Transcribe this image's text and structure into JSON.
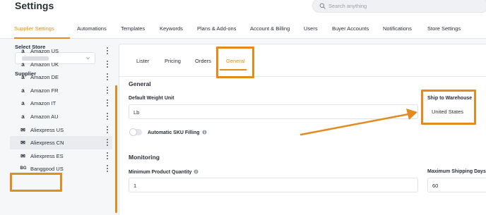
{
  "header": {
    "title": "Settings",
    "search_placeholder": "Search anything",
    "search_icon": "search-icon"
  },
  "nav": {
    "tabs": [
      {
        "label": "Supplier Settings",
        "active": true
      },
      {
        "label": "Automations"
      },
      {
        "label": "Templates"
      },
      {
        "label": "Keywords"
      },
      {
        "label": "Plans & Add-ons"
      },
      {
        "label": "Account & Billing"
      },
      {
        "label": "Users"
      },
      {
        "label": "Buyer Accounts"
      },
      {
        "label": "Notifications"
      },
      {
        "label": "Store Settings"
      }
    ]
  },
  "sidebar": {
    "select_store_label": "Select Store",
    "supplier_label": "Supplier",
    "suppliers": [
      {
        "name": "Amazon US",
        "icon": "amazon-icon",
        "logo": "a"
      },
      {
        "name": "Amazon UK",
        "icon": "amazon-icon",
        "logo": "a"
      },
      {
        "name": "Amazon DE",
        "icon": "amazon-icon",
        "logo": "a"
      },
      {
        "name": "Amazon FR",
        "icon": "amazon-icon",
        "logo": "a"
      },
      {
        "name": "Amazon IT",
        "icon": "amazon-icon",
        "logo": "a"
      },
      {
        "name": "Amazon AU",
        "icon": "amazon-icon",
        "logo": "a"
      },
      {
        "name": "Aliexpress US",
        "icon": "aliexpress-icon",
        "logo": "✉"
      },
      {
        "name": "Aliexpress CN",
        "icon": "aliexpress-icon",
        "logo": "✉",
        "selected": true
      },
      {
        "name": "Aliexpress ES",
        "icon": "aliexpress-icon",
        "logo": "✉"
      },
      {
        "name": "Banggood US",
        "icon": "banggood-icon",
        "logo": "BG"
      }
    ]
  },
  "panel": {
    "subtabs": [
      {
        "label": "Lister"
      },
      {
        "label": "Pricing"
      },
      {
        "label": "Orders"
      },
      {
        "label": "General",
        "active": true
      }
    ],
    "general_title": "General",
    "default_weight_unit_label": "Default Weight Unit",
    "default_weight_unit_value": "Lb",
    "ship_to_warehouse_label": "Ship to Warehouse",
    "ship_to_warehouse_value": "United States",
    "auto_sku_label": "Automatic SKU Filling",
    "auto_sku_enabled": false,
    "monitoring_title": "Monitoring",
    "min_qty_label": "Minimum Product Quantity",
    "min_qty_value": "1",
    "max_shipping_label": "Maximum Shipping Days",
    "max_shipping_value": "60"
  },
  "colors": {
    "accent": "#e48a1f",
    "text": "#2a2f3a"
  }
}
